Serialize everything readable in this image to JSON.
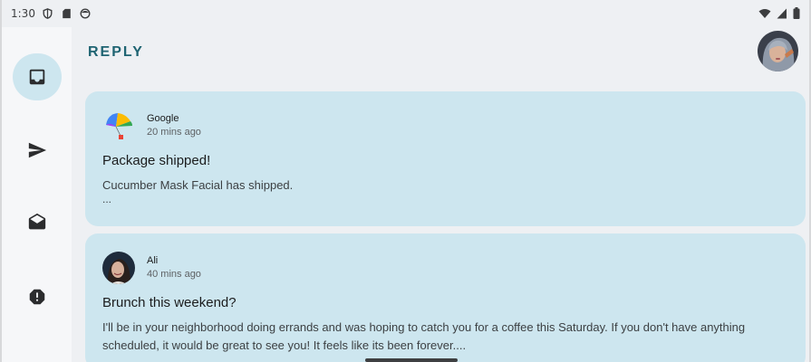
{
  "status_bar": {
    "time": "1:30",
    "icons_left": [
      "shield-icon",
      "sd-card-icon",
      "face-icon"
    ],
    "icons_right": [
      "wifi-icon",
      "signal-icon",
      "battery-icon"
    ]
  },
  "app": {
    "title": "REPLY"
  },
  "rail": {
    "items": [
      {
        "name": "inbox",
        "icon": "inbox-icon",
        "active": true
      },
      {
        "name": "sent",
        "icon": "send-icon",
        "active": false
      },
      {
        "name": "drafts",
        "icon": "open-mail-icon",
        "active": false
      },
      {
        "name": "spam",
        "icon": "report-icon",
        "active": false
      }
    ]
  },
  "emails": [
    {
      "sender": "Google",
      "time": "20 mins ago",
      "subject": "Package shipped!",
      "preview": "Cucumber Mask Facial has shipped.",
      "more": "..."
    },
    {
      "sender": "Ali",
      "time": "40 mins ago",
      "subject": "Brunch this weekend?",
      "preview": "I'll be in your neighborhood doing errands and was hoping to catch you for a coffee this Saturday. If you don't have anything scheduled, it would be great to see you! It feels like its been forever...."
    }
  ],
  "colors": {
    "accent": "#1f6472",
    "card": "#cde6ef",
    "rail_active": "#cde6ef",
    "background": "#eef0f3"
  }
}
